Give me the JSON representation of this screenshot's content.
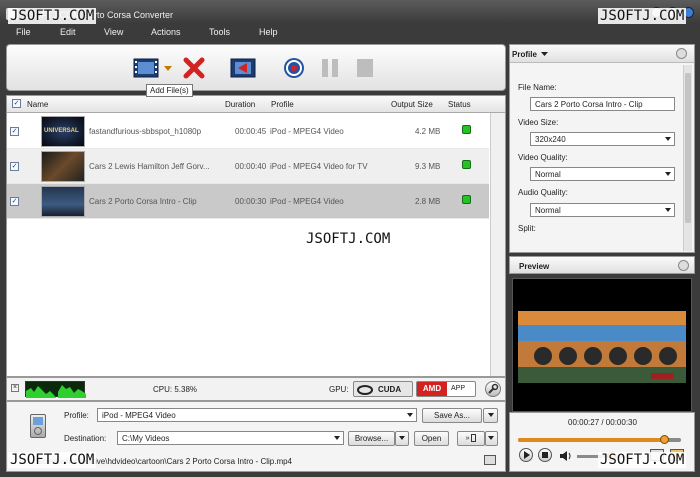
{
  "window": {
    "title": "JSOFTJ.COM Porto Corsa Converter",
    "watermark": "JSOFTJ.COM"
  },
  "menu": [
    "File",
    "Edit",
    "View",
    "Actions",
    "Tools",
    "Help"
  ],
  "toolbar": {
    "tooltip": "Add File(s)"
  },
  "list": {
    "headers": {
      "name": "Name",
      "duration": "Duration",
      "profile": "Profile",
      "output_size": "Output Size",
      "status": "Status"
    },
    "rows": [
      {
        "name": "fastandfurious-sbbspot_h1080p",
        "duration": "00:00:45",
        "profile": "iPod - MPEG4 Video",
        "size": "4.2 MB",
        "thumb_label": "UNIVERSAL"
      },
      {
        "name": "Cars 2 Lewis Hamilton  Jeff Gorv...",
        "duration": "00:00:40",
        "profile": "iPod - MPEG4 Video for TV",
        "size": "9.3 MB",
        "thumb_label": ""
      },
      {
        "name": "Cars 2 Porto Corsa Intro - Clip",
        "duration": "00:00:30",
        "profile": "iPod - MPEG4 Video",
        "size": "2.8 MB",
        "thumb_label": ""
      }
    ]
  },
  "gpu_bar": {
    "cpu": "CPU: 5.38%",
    "gpu_label": "GPU:",
    "cuda": "CUDA",
    "amd": "AMD",
    "app": "APP"
  },
  "bottom": {
    "profile_label": "Profile:",
    "profile_value": "iPod - MPEG4 Video",
    "save_as": "Save As...",
    "destination_label": "Destination:",
    "destination_value": "C:\\My Videos",
    "browse": "Browse...",
    "open": "Open",
    "status_path": "D:\\...\\screenshot relative\\hdvideo\\cartoon\\Cars 2 Porto Corsa Intro - Clip.mp4"
  },
  "profile_panel": {
    "header": "Profile",
    "file_name_label": "File Name:",
    "file_name_value": "Cars 2 Porto Corsa Intro - Clip",
    "video_size_label": "Video Size:",
    "video_size_value": "320x240",
    "video_quality_label": "Video Quality:",
    "video_quality_value": "Normal",
    "audio_quality_label": "Audio Quality:",
    "audio_quality_value": "Normal",
    "split_label": "Split:"
  },
  "preview": {
    "header": "Preview",
    "time": "00:00:27 / 00:00:30",
    "progress": 0.9
  },
  "colors": {
    "accent_red": "#d32222",
    "status_green": "#25c225",
    "selected_row": "#c9c9c9"
  }
}
